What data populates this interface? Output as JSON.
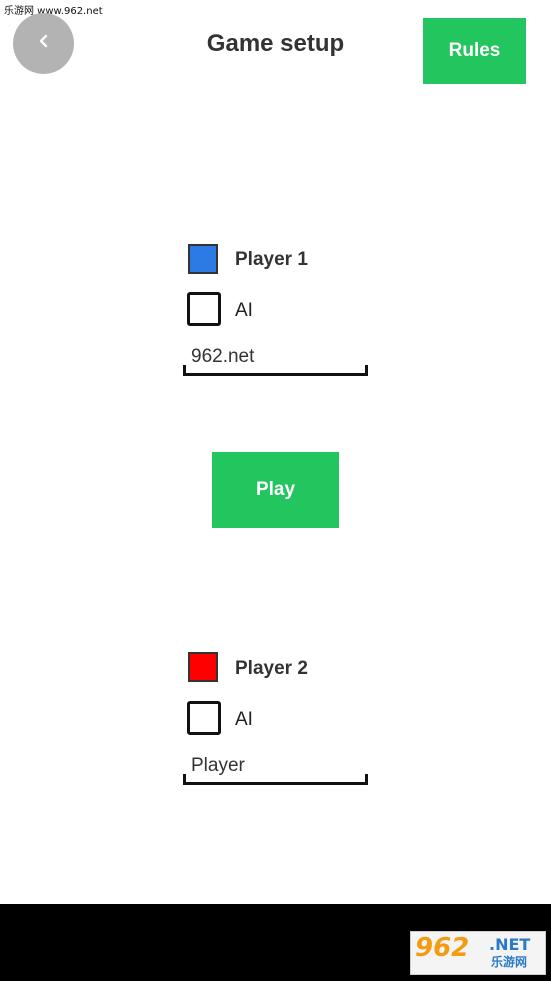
{
  "watermark": {
    "top_text": "乐游网 www.962.net",
    "logo_main": "962",
    "logo_suffix": ".NET",
    "logo_sub": "乐游网"
  },
  "header": {
    "back_icon": "chevron-left-icon",
    "title": "Game setup",
    "rules_label": "Rules"
  },
  "player1": {
    "color": "#2c7be5",
    "label": "Player 1",
    "ai_label": "AI",
    "ai_checked": false,
    "name_value": "962.net"
  },
  "play": {
    "label": "Play"
  },
  "player2": {
    "color": "#ff0000",
    "label": "Player 2",
    "ai_label": "AI",
    "ai_checked": false,
    "name_value": "Player"
  },
  "colors": {
    "accent_green": "#22c55e",
    "back_button_gray": "#b3b3b3",
    "nav_bar": "#000000"
  }
}
